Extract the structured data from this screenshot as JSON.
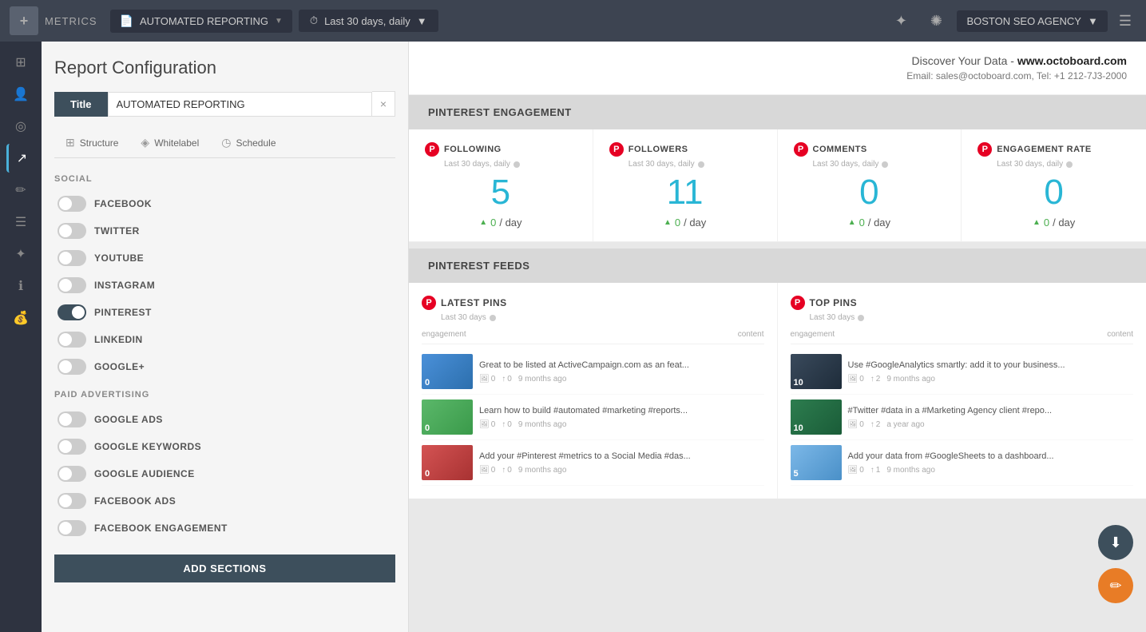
{
  "topnav": {
    "logo": "+",
    "metrics_label": "METRICS",
    "report_dropdown": {
      "icon": "📄",
      "label": "AUTOMATED REPORTING",
      "arrow": "▼"
    },
    "time_dropdown": {
      "icon": "⏱",
      "label": "Last 30 days, daily",
      "arrow": "▼"
    },
    "spark_icon": "✦",
    "flame_icon": "✺",
    "agency": {
      "label": "BOSTON SEO AGENCY",
      "arrow": "▼"
    },
    "hamburger": "☰"
  },
  "config": {
    "title": "Report Configuration",
    "title_tab_label": "Title",
    "title_input_value": "AUTOMATED REPORTING",
    "tabs": [
      {
        "icon": "⊞",
        "label": "Structure"
      },
      {
        "icon": "◈",
        "label": "Whitelabel"
      },
      {
        "icon": "◷",
        "label": "Schedule"
      }
    ],
    "social_header": "SOCIAL",
    "social_items": [
      {
        "label": "FACEBOOK",
        "on": false
      },
      {
        "label": "TWITTER",
        "on": false
      },
      {
        "label": "YOUTUBE",
        "on": false
      },
      {
        "label": "INSTAGRAM",
        "on": false
      },
      {
        "label": "PINTEREST",
        "on": true
      },
      {
        "label": "LINKEDIN",
        "on": false
      },
      {
        "label": "GOOGLE+",
        "on": false
      }
    ],
    "paid_header": "PAID ADVERTISING",
    "paid_items": [
      {
        "label": "GOOGLE ADS",
        "on": false
      },
      {
        "label": "GOOGLE KEYWORDS",
        "on": false
      },
      {
        "label": "GOOGLE AUDIENCE",
        "on": false
      },
      {
        "label": "FACEBOOK ADS",
        "on": false
      },
      {
        "label": "FACEBOOK ENGAGEMENT",
        "on": false
      }
    ],
    "add_btn": "ADD SECTIONS"
  },
  "report": {
    "brand": "Discover Your Data - www.octoboard.com",
    "contact": "Email: sales@octoboard.com, Tel: +1 212-7J3-2000",
    "pinterest_engagement_title": "PINTEREST ENGAGEMENT",
    "metrics": [
      {
        "name": "FOLLOWING",
        "subtitle": "Last 30 days, daily",
        "value": "5",
        "delta": "0",
        "unit": "/ day"
      },
      {
        "name": "FOLLOWERS",
        "subtitle": "Last 30 days, daily",
        "value": "11",
        "delta": "0",
        "unit": "/ day"
      },
      {
        "name": "COMMENTS",
        "subtitle": "Last 30 days, daily",
        "value": "0",
        "delta": "0",
        "unit": "/ day"
      },
      {
        "name": "ENGAGEMENT RATE",
        "subtitle": "Last 30 days, daily",
        "value": "0",
        "delta": "0",
        "unit": "/ day"
      }
    ],
    "pinterest_feeds_title": "PINTEREST FEEDS",
    "latest_pins": {
      "title": "LATEST PINS",
      "subtitle": "Last 30 days",
      "col1": "engagement",
      "col2": "content",
      "items": [
        {
          "thumb_class": "thumb-blue",
          "num": "0",
          "text": "Great to be listed at ActiveCampaign.com as an feat...",
          "likes": "0",
          "repins": "0",
          "time": "9 months ago"
        },
        {
          "thumb_class": "thumb-green",
          "num": "0",
          "text": "Learn how to build #automated #marketing #reports...",
          "likes": "0",
          "repins": "0",
          "time": "9 months ago"
        },
        {
          "thumb_class": "thumb-red",
          "num": "0",
          "text": "Add your #Pinterest #metrics to a Social Media #das...",
          "likes": "0",
          "repins": "0",
          "time": "9 months ago"
        }
      ]
    },
    "top_pins": {
      "title": "TOP PINS",
      "subtitle": "Last 30 days",
      "col1": "engagement",
      "col2": "content",
      "items": [
        {
          "thumb_class": "thumb-dark",
          "num": "10",
          "text": "Use #GoogleAnalytics smartly: add it to your business...",
          "likes": "0",
          "repins": "2",
          "time": "9 months ago"
        },
        {
          "thumb_class": "thumb-forest",
          "num": "10",
          "text": "#Twitter #data in a #Marketing Agency client #repo...",
          "likes": "0",
          "repins": "2",
          "time": "a year ago"
        },
        {
          "thumb_class": "thumb-chart",
          "num": "5",
          "text": "Add your data from #GoogleSheets to a dashboard...",
          "likes": "0",
          "repins": "1",
          "time": "9 months ago"
        }
      ]
    }
  },
  "sidebar_icons": [
    "⊞",
    "👤",
    "◎",
    "↗",
    "✏",
    "☰",
    "✦",
    "ℹ",
    "💰"
  ]
}
